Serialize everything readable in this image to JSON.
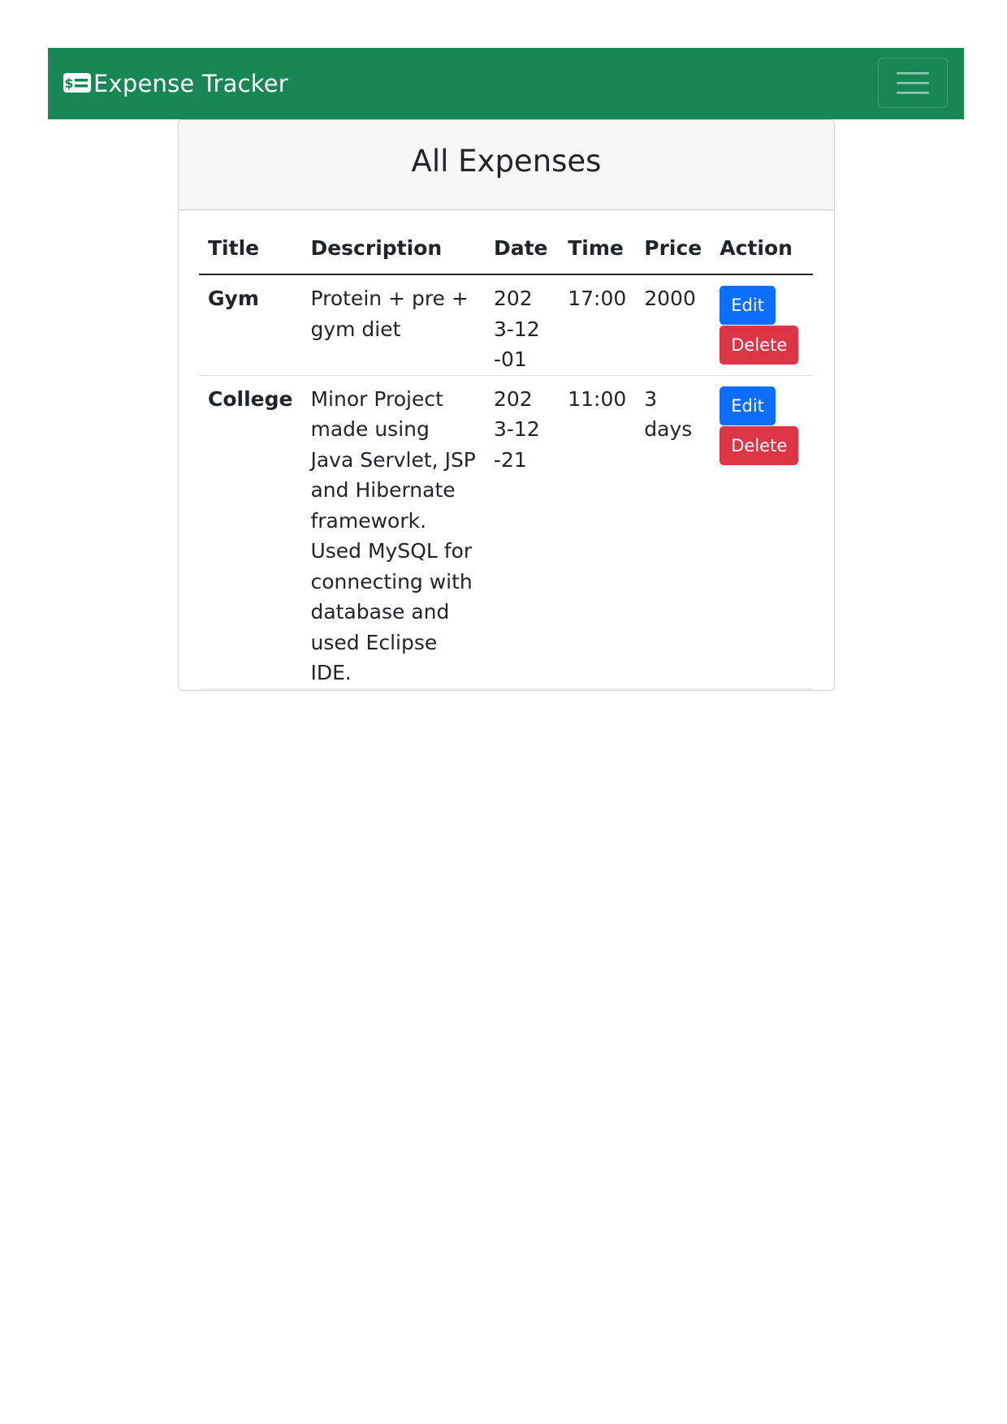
{
  "navbar": {
    "brand": "Expense Tracker",
    "brand_icon": "cash-icon",
    "toggler_icon": "hamburger-menu-icon",
    "color": "#198754"
  },
  "card": {
    "title": "All Expenses"
  },
  "table": {
    "headers": {
      "title": "Title",
      "description": "Description",
      "date": "Date",
      "time": "Time",
      "price": "Price",
      "action": "Action"
    },
    "rows": [
      {
        "title": "Gym",
        "description": "Protein + pre + gym diet",
        "date": "2023-12-01",
        "time": "17:00",
        "price": "2000",
        "edit_label": "Edit",
        "delete_label": "Delete"
      },
      {
        "title": "College",
        "description": "Minor Project made using Java Servlet, JSP and Hibernate framework. Used MySQL for connecting with database and used Eclipse IDE.",
        "date": "2023-12-21",
        "time": "11:00",
        "price": "3 days",
        "edit_label": "Edit",
        "delete_label": "Delete"
      }
    ]
  },
  "colors": {
    "edit_button": "#0d6efd",
    "delete_button": "#dc3545"
  }
}
